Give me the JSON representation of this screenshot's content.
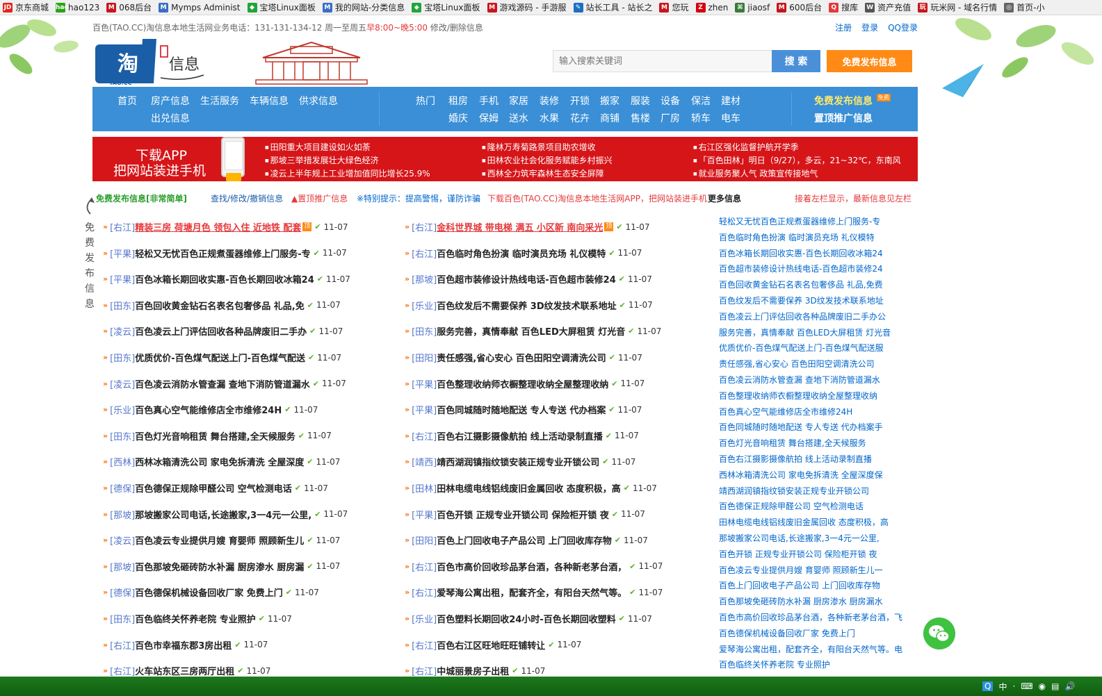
{
  "bookmarks": [
    {
      "label": "京东商城",
      "icon": "jd-icon",
      "color": "#e1251b",
      "glyph": "JD"
    },
    {
      "label": "hao123",
      "icon": "hao123-icon",
      "color": "#2aa515",
      "glyph": "hao"
    },
    {
      "label": "068后台",
      "icon": "m-icon",
      "color": "#c8161d",
      "glyph": "M"
    },
    {
      "label": "Mymps Administ",
      "icon": "m-icon",
      "color": "#3b6ec4",
      "glyph": "M"
    },
    {
      "label": "宝塔Linux面板",
      "icon": "shield-icon",
      "color": "#20a53a",
      "glyph": "◆"
    },
    {
      "label": "我的网站-分类信息",
      "icon": "m-icon",
      "color": "#3b6ec4",
      "glyph": "M"
    },
    {
      "label": "宝塔Linux面板",
      "icon": "shield-icon",
      "color": "#20a53a",
      "glyph": "◆"
    },
    {
      "label": "游戏源码 - 手游服",
      "icon": "m-icon",
      "color": "#c8161d",
      "glyph": "M"
    },
    {
      "label": "站长工具 - 站长之",
      "icon": "tool-icon",
      "color": "#1d6fc2",
      "glyph": "✎"
    },
    {
      "label": "您玩",
      "icon": "m-icon",
      "color": "#c8161d",
      "glyph": "M"
    },
    {
      "label": "zhen",
      "icon": "z-icon",
      "color": "#d6000f",
      "glyph": "Z"
    },
    {
      "label": "jiaosf",
      "icon": "pen-icon",
      "color": "#3a7a3a",
      "glyph": "⌘"
    },
    {
      "label": "600后台",
      "icon": "m-icon",
      "color": "#c8161d",
      "glyph": "M"
    },
    {
      "label": "搜库",
      "icon": "search-icon",
      "color": "#e4393c",
      "glyph": "Q"
    },
    {
      "label": "资产充值",
      "icon": "wordpress-icon",
      "color": "#555",
      "glyph": "W"
    },
    {
      "label": "玩米网 - 域名行情",
      "icon": "wanmi-icon",
      "color": "#c8161d",
      "glyph": "玩"
    },
    {
      "label": "首页-小",
      "icon": "globe-icon",
      "color": "#666",
      "glyph": "◎"
    }
  ],
  "topbar": {
    "notice_prefix": "百色(TAO.CC)淘信息本地生活网业务电话：131-131-134-12 周一至周五",
    "notice_hot": "早8:00~晚5:00",
    "notice_suffix": " 修改/删除信息",
    "links": [
      "注册",
      "登录",
      "QQ登录"
    ]
  },
  "header": {
    "logo_text": "淘",
    "logo_sub": "TAO.CC",
    "logo_right": "信息",
    "search_placeholder": "输入搜索关键词",
    "search_btn": "搜 索",
    "publish_btn": "免费发布信息"
  },
  "nav": {
    "left_row1": [
      "首页",
      "房产信息",
      "生活服务",
      "车辆信息",
      "供求信息"
    ],
    "left_row2": [
      "出兑信息"
    ],
    "mid_row1": [
      "热门",
      "租房",
      "手机",
      "家居",
      "装修",
      "开锁",
      "搬家",
      "服装",
      "设备",
      "保洁",
      "建材"
    ],
    "mid_row2": [
      "婚庆",
      "保姆",
      "送水",
      "水果",
      "花卉",
      "商铺",
      "售楼",
      "厂房",
      "轿车",
      "电车"
    ],
    "right_row1": "免费发布信息",
    "right_badge": "免费",
    "right_row2": "置顶推广信息"
  },
  "banner": {
    "title1": "下载APP",
    "title2": "把网站装进手机",
    "col1": [
      "田阳重大项目建设如火如荼",
      "那坡三举措发展壮大绿色经济",
      "凌云上半年规上工业增加值同比增长25.9%"
    ],
    "col2": [
      "隆林万寿菊路景项目助农增收",
      "田林农业社会化服务赋能乡村振兴",
      "西林全力筑牢森林生态安全屏障"
    ],
    "col3": [
      "右江区强化监督护航开学季",
      "「百色田林」明日（9/27），多云，21~32℃，东南风",
      "就业服务聚人气 政策宣传接地气"
    ]
  },
  "tipbar": {
    "free": "免费发布信息[非常简单]",
    "find": "查找/修改/撤销信息",
    "top": "▲置顶推广信息",
    "warn": "※特别提示：提高警惕，谨防诈骗",
    "app": "下载百色(TAO.CC)淘信息本地生活网APP，把网站装进手机",
    "more": "更多信息",
    "right": "接着左栏显示，最新信息见左栏"
  },
  "sidebar_text": "免费发布信息",
  "left_list": [
    {
      "region": "[右江]",
      "title": "精装三房 荷塘月色 领包入住 近地铁 配套",
      "date": "11-07",
      "hot": true,
      "badge": "顶"
    },
    {
      "region": "[平果]",
      "title": "轻松又无忧百色正规煮蛋器维修上门服务-专",
      "date": "11-07"
    },
    {
      "region": "[平果]",
      "title": "百色冰箱长期回收实惠-百色长期回收冰箱24",
      "date": "11-07"
    },
    {
      "region": "[田东]",
      "title": "百色回收黄金钻石名表名包奢侈品 礼品,免",
      "date": "11-07"
    },
    {
      "region": "[凌云]",
      "title": "百色凌云上门评估回收各种品牌废旧二手办",
      "date": "11-07"
    },
    {
      "region": "[田东]",
      "title": "优质优价-百色煤气配送上门-百色煤气配送",
      "date": "11-07"
    },
    {
      "region": "[凌云]",
      "title": "百色凌云消防水管查漏 查地下消防管道漏水",
      "date": "11-07"
    },
    {
      "region": "[乐业]",
      "title": "百色真心空气能维修店全市维修24H",
      "date": "11-07"
    },
    {
      "region": "[田东]",
      "title": "百色灯光音响租赁 舞台搭建,全天候服务",
      "date": "11-07"
    },
    {
      "region": "[西林]",
      "title": "西林冰箱清洗公司 家电免拆清洗 全屋深度",
      "date": "11-07"
    },
    {
      "region": "[德保]",
      "title": "百色德保正规除甲醛公司 空气检测电话",
      "date": "11-07"
    },
    {
      "region": "[那坡]",
      "title": "那坡搬家公司电话,长途搬家,3一4元一公里,",
      "date": "11-07"
    },
    {
      "region": "[凌云]",
      "title": "百色凌云专业提供月嫂 育婴师 照顾新生儿",
      "date": "11-07"
    },
    {
      "region": "[那坡]",
      "title": "百色那坡免砸砖防水补漏 厨房渗水 厨房漏",
      "date": "11-07"
    },
    {
      "region": "[德保]",
      "title": "百色德保机械设备回收厂家 免费上门",
      "date": "11-07"
    },
    {
      "region": "[田东]",
      "title": "百色临终关怀养老院 专业照护",
      "date": "11-07"
    },
    {
      "region": "[右江]",
      "title": "百色市幸福东郡3房出租",
      "date": "11-07"
    },
    {
      "region": "[右江]",
      "title": "火车站东区三房两厅出租",
      "date": "11-07"
    }
  ],
  "mid_list": [
    {
      "region": "[右江]",
      "title": "金科世界城 带电梯 满五 小区新 南向采光",
      "date": "11-07",
      "hot": true,
      "badge": "顶"
    },
    {
      "region": "[右江]",
      "title": "百色临时角色扮演 临时演员充场 礼仪模特",
      "date": "11-07"
    },
    {
      "region": "[那坡]",
      "title": "百色超市装修设计热线电话-百色超市装修24",
      "date": "11-07"
    },
    {
      "region": "[乐业]",
      "title": "百色纹发后不需要保养 3D纹发技术联系地址",
      "date": "11-07"
    },
    {
      "region": "[田东]",
      "title": "服务完善，真情奉献 百色LED大屏租赁 灯光音",
      "date": "11-07"
    },
    {
      "region": "[田阳]",
      "title": "责任感强,省心安心 百色田阳空调清洗公司",
      "date": "11-07"
    },
    {
      "region": "[平果]",
      "title": "百色整理收纳师衣橱整理收纳全屋整理收纳",
      "date": "11-07"
    },
    {
      "region": "[平果]",
      "title": "百色同城随时随地配送 专人专送 代办档案",
      "date": "11-07"
    },
    {
      "region": "[右江]",
      "title": "百色右江摄影摄像航拍 线上活动录制直播",
      "date": "11-07"
    },
    {
      "region": "[靖西]",
      "title": "靖西湖润镇指纹锁安装正规专业开锁公司",
      "date": "11-07"
    },
    {
      "region": "[田林]",
      "title": "田林电缆电线铝线废旧金属回收 态度积极，高",
      "date": "11-07"
    },
    {
      "region": "[平果]",
      "title": "百色开锁 正规专业开锁公司 保险柜开锁 夜",
      "date": "11-07"
    },
    {
      "region": "[田阳]",
      "title": "百色上门回收电子产品公司 上门回收库存物",
      "date": "11-07"
    },
    {
      "region": "[右江]",
      "title": "百色市高价回收珍品茅台酒，各种新老茅台酒，",
      "date": "11-07"
    },
    {
      "region": "[右江]",
      "title": "爱琴海公寓出租，配套齐全，有阳台天然气等。",
      "date": "11-07"
    },
    {
      "region": "[乐业]",
      "title": "百色塑料长期回收24小时-百色长期回收塑料",
      "date": "11-07"
    },
    {
      "region": "[右江]",
      "title": "百色右江区旺地旺旺铺转让",
      "date": "11-07"
    },
    {
      "region": "[右江]",
      "title": "中城丽景房子出租",
      "date": "11-07"
    }
  ],
  "right_list": [
    "轻松又无忧百色正规煮蛋器维修上门服务-专",
    "百色临时角色扮演 临时演员充场 礼仪模特",
    "百色冰箱长期回收实惠-百色长期回收冰箱24",
    "百色超市装修设计热线电话-百色超市装修24",
    "百色回收黄金钻石名表名包奢侈品 礼品,免费",
    "百色纹发后不需要保养 3D纹发技术联系地址",
    "百色凌云上门评估回收各种品牌废旧二手办公",
    "服务完善，真情奉献 百色LED大屏租赁 灯光音",
    "优质优价-百色煤气配送上门-百色煤气配送服",
    "责任感强,省心安心 百色田阳空调清洗公司",
    "百色凌云消防水管查漏 查地下消防管道漏水",
    "百色整理收纳师衣橱整理收纳全屋整理收纳",
    "百色真心空气能维修店全市维修24H",
    "百色同城随时随地配送 专人专送 代办档案手",
    "百色灯光音响租赁 舞台搭建,全天候服务",
    "百色右江摄影摄像航拍 线上活动录制直播",
    "西林冰箱清洗公司 家电免拆清洗 全屋深度保",
    "靖西湖润镇指纹锁安装正规专业开锁公司",
    "百色德保正规除甲醛公司 空气检测电话",
    "田林电缆电线铝线废旧金属回收 态度积极，高",
    "那坡搬家公司电话,长途搬家,3一4元一公里,",
    "百色开锁 正规专业开锁公司 保险柜开锁 夜",
    "百色凌云专业提供月嫂 育婴师 照顾新生儿一",
    "百色上门回收电子产品公司 上门回收库存物",
    "百色那坡免砸砖防水补漏 厨房渗水 厨房漏水",
    "百色市高价回收珍品茅台酒，各种新老茅台酒，飞",
    "百色德保机械设备回收厂家 免费上门",
    "爱琴海公寓出租，配套齐全，有阳台天然气等。电",
    "百色临终关怀养老院 专业照护"
  ],
  "tray": {
    "ime": "中",
    "ime2": "·",
    "items": [
      "⌨",
      "◉",
      "▤",
      "🔊"
    ]
  }
}
